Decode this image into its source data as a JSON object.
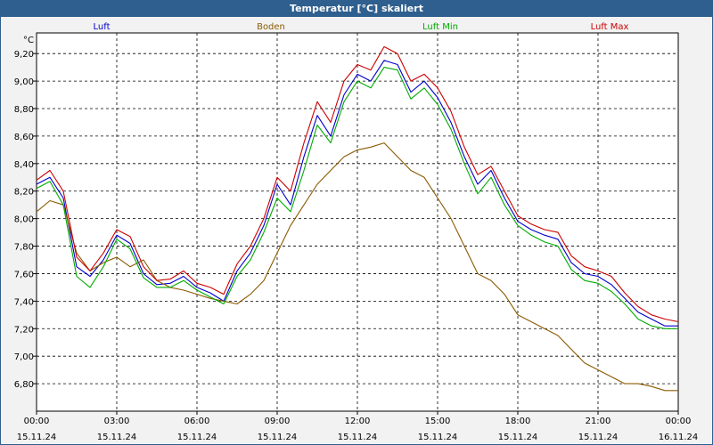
{
  "window": {
    "title": "Temperatur [°C] skaliert"
  },
  "chart_data": {
    "type": "line",
    "title": "Temperatur [°C] skaliert",
    "ylabel": "°C",
    "xlabel": "",
    "ylim": [
      6.6,
      9.35
    ],
    "y_ticks": [
      "6,80",
      "7,00",
      "7,20",
      "7,40",
      "7,60",
      "7,80",
      "8,00",
      "8,20",
      "8,40",
      "8,60",
      "8,80",
      "9,00",
      "9,20"
    ],
    "y_tick_values": [
      6.8,
      7.0,
      7.2,
      7.4,
      7.6,
      7.8,
      8.0,
      8.2,
      8.4,
      8.6,
      8.8,
      9.0,
      9.2
    ],
    "x_ticks": [
      {
        "time": "00:00",
        "date": "15.11.24",
        "hour": 0
      },
      {
        "time": "03:00",
        "date": "15.11.24",
        "hour": 3
      },
      {
        "time": "06:00",
        "date": "15.11.24",
        "hour": 6
      },
      {
        "time": "09:00",
        "date": "15.11.24",
        "hour": 9
      },
      {
        "time": "12:00",
        "date": "15.11.24",
        "hour": 12
      },
      {
        "time": "15:00",
        "date": "15.11.24",
        "hour": 15
      },
      {
        "time": "18:00",
        "date": "15.11.24",
        "hour": 18
      },
      {
        "time": "21:00",
        "date": "15.11.24",
        "hour": 21
      },
      {
        "time": "00:00",
        "date": "16.11.24",
        "hour": 24
      }
    ],
    "legend_placement": "top",
    "grid": true,
    "series": [
      {
        "name": "Luft",
        "color": "#0000cc",
        "x": [
          0,
          0.5,
          1,
          1.5,
          2,
          2.5,
          3,
          3.5,
          4,
          4.5,
          5,
          5.5,
          6,
          6.5,
          7,
          7.5,
          8,
          8.5,
          9,
          9.5,
          10,
          10.5,
          11,
          11.5,
          12,
          12.5,
          13,
          13.5,
          14,
          14.5,
          15,
          15.5,
          16,
          16.5,
          17,
          17.5,
          18,
          18.5,
          19,
          19.5,
          20,
          20.5,
          21,
          21.5,
          22,
          22.5,
          23,
          23.5,
          24
        ],
        "values": [
          8.25,
          8.3,
          8.15,
          7.65,
          7.58,
          7.7,
          7.88,
          7.82,
          7.6,
          7.52,
          7.53,
          7.58,
          7.5,
          7.46,
          7.4,
          7.62,
          7.75,
          7.95,
          8.25,
          8.1,
          8.45,
          8.75,
          8.6,
          8.9,
          9.05,
          9.0,
          9.15,
          9.12,
          8.92,
          9.0,
          8.88,
          8.7,
          8.45,
          8.25,
          8.35,
          8.15,
          7.98,
          7.92,
          7.88,
          7.85,
          7.68,
          7.6,
          7.58,
          7.52,
          7.42,
          7.32,
          7.27,
          7.22,
          7.22
        ]
      },
      {
        "name": "Boden",
        "color": "#8b5a00",
        "x": [
          0,
          0.5,
          1,
          1.5,
          2,
          2.5,
          3,
          3.5,
          4,
          4.5,
          5,
          5.5,
          6,
          6.5,
          7,
          7.5,
          8,
          8.5,
          9,
          9.5,
          10,
          10.5,
          11,
          11.5,
          12,
          12.5,
          13,
          13.5,
          14,
          14.5,
          15,
          15.5,
          16,
          16.5,
          17,
          17.5,
          18,
          18.5,
          19,
          19.5,
          20,
          20.5,
          21,
          21.5,
          22,
          22.5,
          23,
          23.5,
          24
        ],
        "values": [
          8.05,
          8.13,
          8.1,
          7.75,
          7.62,
          7.68,
          7.72,
          7.65,
          7.7,
          7.55,
          7.5,
          7.48,
          7.45,
          7.42,
          7.4,
          7.38,
          7.45,
          7.55,
          7.75,
          7.95,
          8.1,
          8.25,
          8.35,
          8.45,
          8.5,
          8.52,
          8.55,
          8.45,
          8.35,
          8.3,
          8.15,
          8.0,
          7.8,
          7.6,
          7.55,
          7.45,
          7.3,
          7.25,
          7.2,
          7.15,
          7.05,
          6.95,
          6.9,
          6.85,
          6.8,
          6.8,
          6.78,
          6.75,
          6.75
        ]
      },
      {
        "name": "Luft Min",
        "color": "#00aa00",
        "x": [
          0,
          0.5,
          1,
          1.5,
          2,
          2.5,
          3,
          3.5,
          4,
          4.5,
          5,
          5.5,
          6,
          6.5,
          7,
          7.5,
          8,
          8.5,
          9,
          9.5,
          10,
          10.5,
          11,
          11.5,
          12,
          12.5,
          13,
          13.5,
          14,
          14.5,
          15,
          15.5,
          16,
          16.5,
          17,
          17.5,
          18,
          18.5,
          19,
          19.5,
          20,
          20.5,
          21,
          21.5,
          22,
          22.5,
          23,
          23.5,
          24
        ],
        "values": [
          8.22,
          8.27,
          8.1,
          7.58,
          7.5,
          7.65,
          7.85,
          7.78,
          7.57,
          7.5,
          7.5,
          7.55,
          7.48,
          7.43,
          7.38,
          7.58,
          7.7,
          7.9,
          8.15,
          8.05,
          8.35,
          8.68,
          8.55,
          8.85,
          9.0,
          8.95,
          9.1,
          9.08,
          8.87,
          8.95,
          8.83,
          8.65,
          8.4,
          8.18,
          8.3,
          8.1,
          7.95,
          7.88,
          7.83,
          7.8,
          7.63,
          7.55,
          7.53,
          7.47,
          7.38,
          7.27,
          7.22,
          7.2,
          7.2
        ]
      },
      {
        "name": "Luft Max",
        "color": "#cc0000",
        "x": [
          0,
          0.5,
          1,
          1.5,
          2,
          2.5,
          3,
          3.5,
          4,
          4.5,
          5,
          5.5,
          6,
          6.5,
          7,
          7.5,
          8,
          8.5,
          9,
          9.5,
          10,
          10.5,
          11,
          11.5,
          12,
          12.5,
          13,
          13.5,
          14,
          14.5,
          15,
          15.5,
          16,
          16.5,
          17,
          17.5,
          18,
          18.5,
          19,
          19.5,
          20,
          20.5,
          21,
          21.5,
          22,
          22.5,
          23,
          23.5,
          24
        ],
        "values": [
          8.28,
          8.35,
          8.2,
          7.72,
          7.62,
          7.75,
          7.92,
          7.87,
          7.65,
          7.55,
          7.56,
          7.62,
          7.53,
          7.5,
          7.45,
          7.67,
          7.8,
          8.0,
          8.3,
          8.2,
          8.55,
          8.85,
          8.7,
          9.0,
          9.12,
          9.08,
          9.25,
          9.2,
          9.0,
          9.05,
          8.95,
          8.78,
          8.52,
          8.32,
          8.38,
          8.2,
          8.02,
          7.96,
          7.92,
          7.9,
          7.73,
          7.65,
          7.62,
          7.58,
          7.46,
          7.36,
          7.3,
          7.27,
          7.25
        ]
      }
    ]
  }
}
